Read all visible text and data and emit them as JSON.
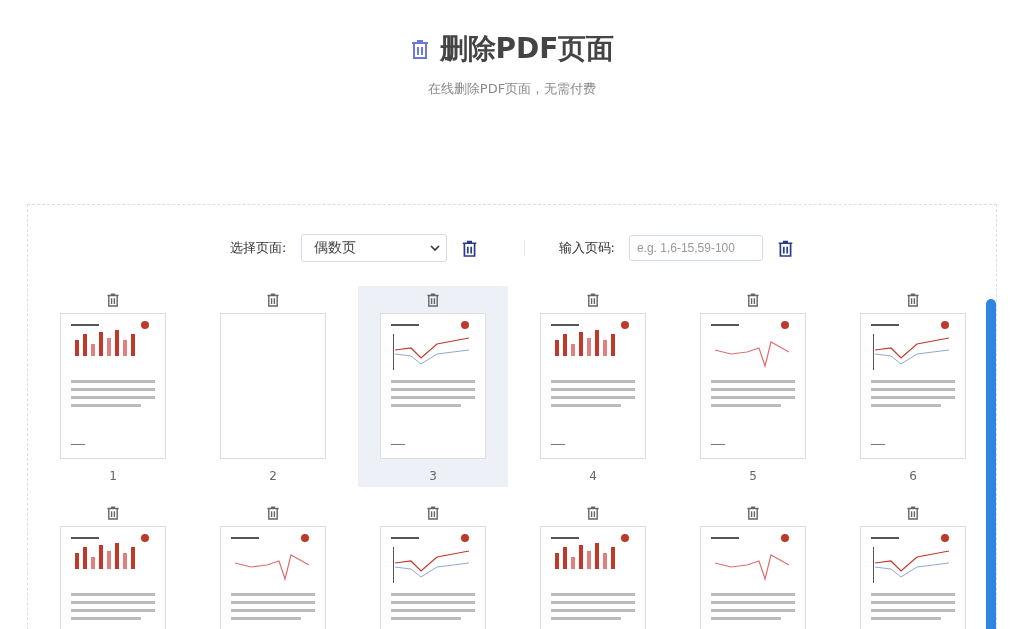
{
  "header": {
    "title": "删除PDF页面",
    "subtitle": "在线删除PDF页面，无需付费"
  },
  "toolbar": {
    "select_label": "选择页面:",
    "select_value": "偶数页",
    "range_label": "输入页码:",
    "range_placeholder": "e.g. 1,6-15,59-100"
  },
  "pages": [
    {
      "number": "1",
      "kind": "document",
      "selected": false
    },
    {
      "number": "2",
      "kind": "blank",
      "selected": false
    },
    {
      "number": "3",
      "kind": "document",
      "selected": true
    },
    {
      "number": "4",
      "kind": "document",
      "selected": false
    },
    {
      "number": "5",
      "kind": "document",
      "selected": false
    },
    {
      "number": "6",
      "kind": "document",
      "selected": false
    },
    {
      "kind": "document",
      "selected": false
    },
    {
      "kind": "document",
      "selected": false
    },
    {
      "kind": "document",
      "selected": false
    },
    {
      "kind": "document",
      "selected": false
    },
    {
      "kind": "document",
      "selected": false
    },
    {
      "kind": "document",
      "selected": false
    }
  ]
}
